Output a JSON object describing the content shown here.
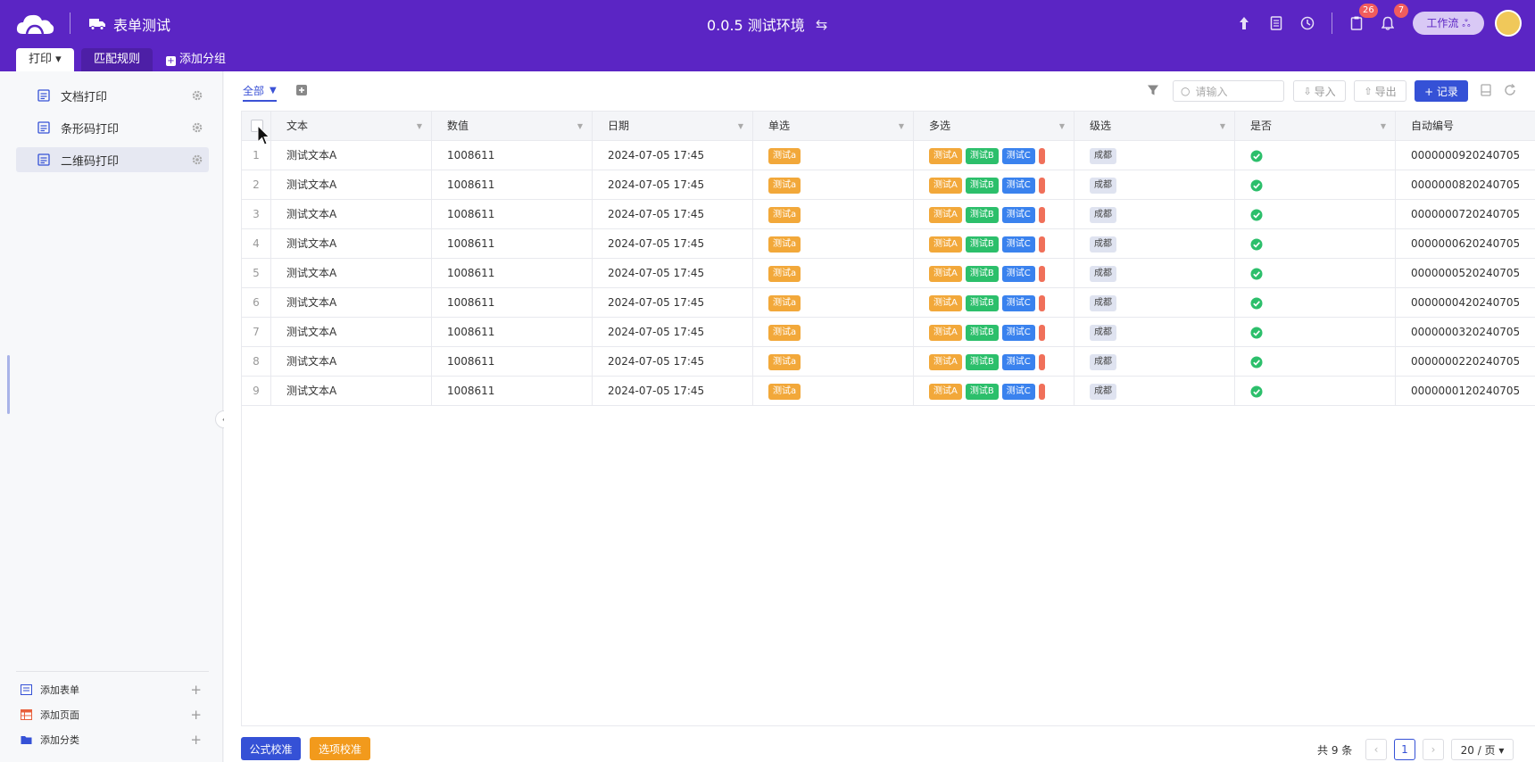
{
  "header": {
    "app_name": "表单测试",
    "env_title": "0.0.5 测试环境",
    "swap_glyph": "⇆",
    "badges": {
      "tasks": "26",
      "notifications": "7"
    },
    "workflow_label": "工作流 ஃ",
    "tabs": [
      {
        "label": "打印 ▾"
      },
      {
        "label": "匹配规则"
      },
      {
        "label": "添加分组"
      }
    ]
  },
  "sidebar": {
    "items": [
      {
        "label": "文档打印"
      },
      {
        "label": "条形码打印"
      },
      {
        "label": "二维码打印"
      }
    ],
    "bottom": [
      {
        "label": "添加表单"
      },
      {
        "label": "添加页面"
      },
      {
        "label": "添加分类"
      }
    ]
  },
  "toolbar": {
    "view_label": "全部",
    "search_placeholder": "请输入",
    "import_label": "导入",
    "export_label": "导出",
    "record_label": "+ 记录"
  },
  "table": {
    "columns": [
      "文本",
      "数值",
      "日期",
      "单选",
      "多选",
      "级选",
      "是否",
      "自动编号"
    ],
    "rows": [
      {
        "idx": "1",
        "text": "测试文本A",
        "num": "1008611",
        "date": "2024-07-05 17:45",
        "single": "测试a",
        "multi": [
          "测试A",
          "测试B",
          "测试C"
        ],
        "level": "成都",
        "auto": "0000000920240705"
      },
      {
        "idx": "2",
        "text": "测试文本A",
        "num": "1008611",
        "date": "2024-07-05 17:45",
        "single": "测试a",
        "multi": [
          "测试A",
          "测试B",
          "测试C"
        ],
        "level": "成都",
        "auto": "0000000820240705"
      },
      {
        "idx": "3",
        "text": "测试文本A",
        "num": "1008611",
        "date": "2024-07-05 17:45",
        "single": "测试a",
        "multi": [
          "测试A",
          "测试B",
          "测试C"
        ],
        "level": "成都",
        "auto": "0000000720240705"
      },
      {
        "idx": "4",
        "text": "测试文本A",
        "num": "1008611",
        "date": "2024-07-05 17:45",
        "single": "测试a",
        "multi": [
          "测试A",
          "测试B",
          "测试C"
        ],
        "level": "成都",
        "auto": "0000000620240705"
      },
      {
        "idx": "5",
        "text": "测试文本A",
        "num": "1008611",
        "date": "2024-07-05 17:45",
        "single": "测试a",
        "multi": [
          "测试A",
          "测试B",
          "测试C"
        ],
        "level": "成都",
        "auto": "0000000520240705"
      },
      {
        "idx": "6",
        "text": "测试文本A",
        "num": "1008611",
        "date": "2024-07-05 17:45",
        "single": "测试a",
        "multi": [
          "测试A",
          "测试B",
          "测试C"
        ],
        "level": "成都",
        "auto": "0000000420240705"
      },
      {
        "idx": "7",
        "text": "测试文本A",
        "num": "1008611",
        "date": "2024-07-05 17:45",
        "single": "测试a",
        "multi": [
          "测试A",
          "测试B",
          "测试C"
        ],
        "level": "成都",
        "auto": "0000000320240705"
      },
      {
        "idx": "8",
        "text": "测试文本A",
        "num": "1008611",
        "date": "2024-07-05 17:45",
        "single": "测试a",
        "multi": [
          "测试A",
          "测试B",
          "测试C"
        ],
        "level": "成都",
        "auto": "0000000220240705"
      },
      {
        "idx": "9",
        "text": "测试文本A",
        "num": "1008611",
        "date": "2024-07-05 17:45",
        "single": "测试a",
        "multi": [
          "测试A",
          "测试B",
          "测试C"
        ],
        "level": "成都",
        "auto": "0000000120240705"
      }
    ]
  },
  "footer": {
    "formula_check": "公式校准",
    "option_check": "选项校准",
    "total": "共 9 条",
    "current_page": "1",
    "page_size": "20 / 页 ▾"
  },
  "colors": {
    "header_bg": "#5b25c4",
    "primary": "#3551d6",
    "tag_yellow": "#f2a83a",
    "tag_green": "#2cbf6b",
    "tag_blue": "#3a82ee",
    "footer_orange": "#f29a1c"
  }
}
